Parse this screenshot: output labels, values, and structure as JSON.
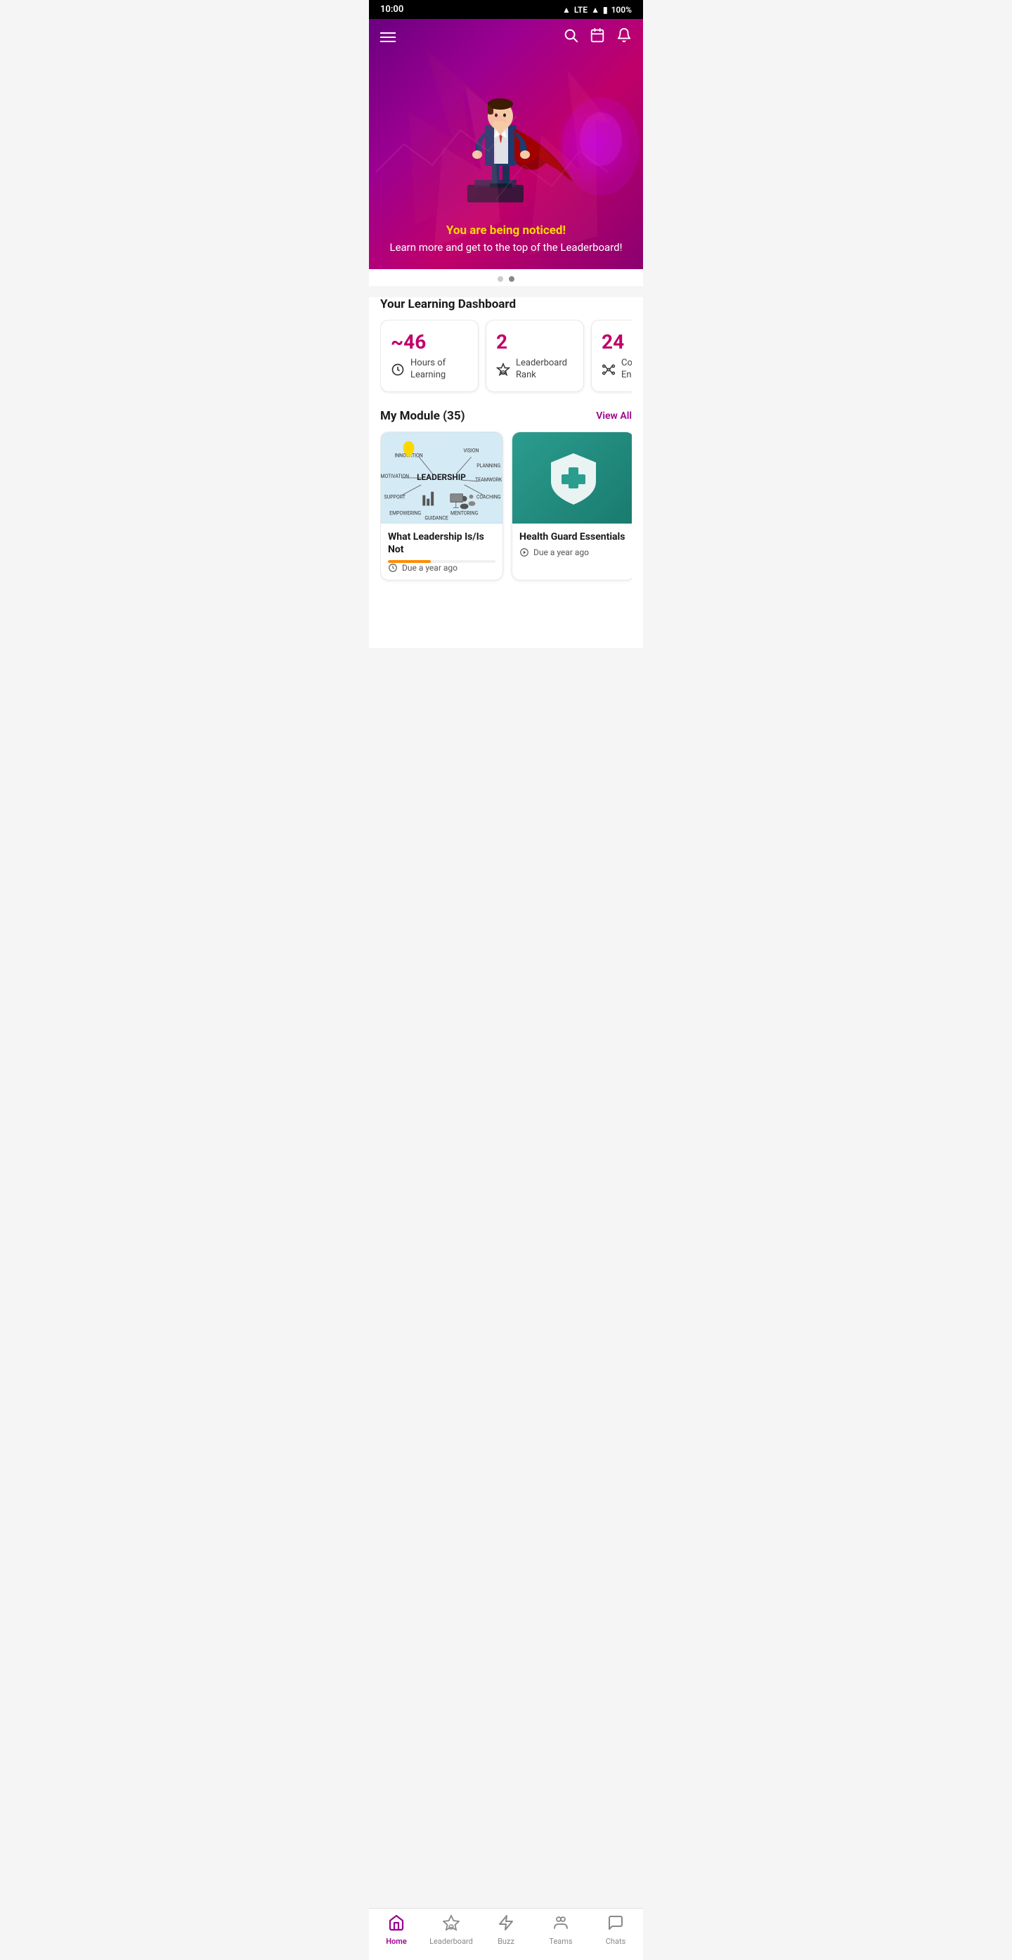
{
  "statusBar": {
    "time": "10:00",
    "signal": "LTE",
    "battery": "100%"
  },
  "heroNav": {
    "searchAriaLabel": "search",
    "calendarAriaLabel": "calendar",
    "notificationAriaLabel": "notification"
  },
  "hero": {
    "headline": "You are being noticed!",
    "subtext": "Learn more and get to the top of the Leaderboard!"
  },
  "pagination": {
    "dots": [
      false,
      true
    ]
  },
  "dashboard": {
    "title": "Your Learning Dashboard",
    "cards": [
      {
        "number": "~46",
        "label": "Hours of Learning",
        "icon": "clock"
      },
      {
        "number": "2",
        "label": "Leaderboard Rank",
        "icon": "medal"
      },
      {
        "number": "24",
        "label": "Courses Enrolled",
        "icon": "network"
      }
    ]
  },
  "modules": {
    "title": "My Module",
    "count": 35,
    "viewAllLabel": "View All",
    "items": [
      {
        "title": "What Leadership Is/Is Not",
        "dueLabel": "Due a year ago",
        "progress": 40,
        "type": "leadership"
      },
      {
        "title": "Health Guard Essentials",
        "dueLabel": "Due a year ago",
        "progress": 0,
        "type": "health"
      }
    ]
  },
  "bottomNav": {
    "items": [
      {
        "label": "Home",
        "icon": "home",
        "active": true
      },
      {
        "label": "Leaderboard",
        "icon": "medal",
        "active": false
      },
      {
        "label": "Buzz",
        "icon": "buzz",
        "active": false
      },
      {
        "label": "Teams",
        "icon": "teams",
        "active": false
      },
      {
        "label": "Chats",
        "icon": "chats",
        "active": false
      }
    ]
  }
}
